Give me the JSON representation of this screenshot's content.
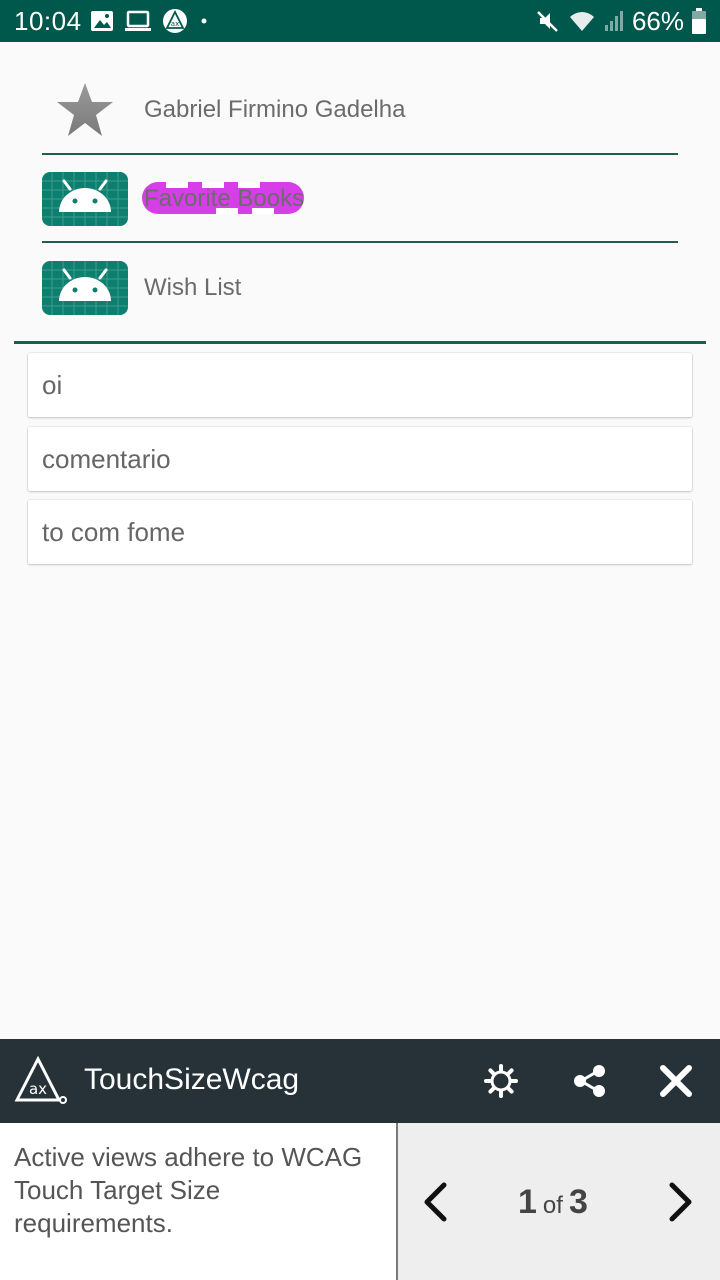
{
  "status_bar": {
    "time": "10:04",
    "battery": "66%",
    "icons": [
      "image-icon",
      "laptop-icon",
      "ax-app-icon",
      "dot-icon",
      "mute-icon",
      "wifi-icon",
      "signal-icon",
      "battery-icon"
    ]
  },
  "menu": {
    "items": [
      {
        "label": "Gabriel Firmino Gadelha",
        "icon": "star-icon"
      },
      {
        "label": "Favorite Books",
        "icon": "android-icon"
      },
      {
        "label": "Wish List",
        "icon": "android-icon"
      }
    ]
  },
  "comments": [
    "oi",
    "comentario",
    "to com fome"
  ],
  "accessibility_panel": {
    "title": "TouchSizeWcag",
    "message": "Active views adhere to WCAG Touch Target Size requirements.",
    "page_current": "1",
    "page_of": "of",
    "page_total": "3"
  },
  "colors": {
    "status_bar": "#00574b",
    "divider": "#1f5c52",
    "android_tile": "#0d7f6f",
    "highlight": "#d63ee8",
    "panel_header": "#263238"
  }
}
